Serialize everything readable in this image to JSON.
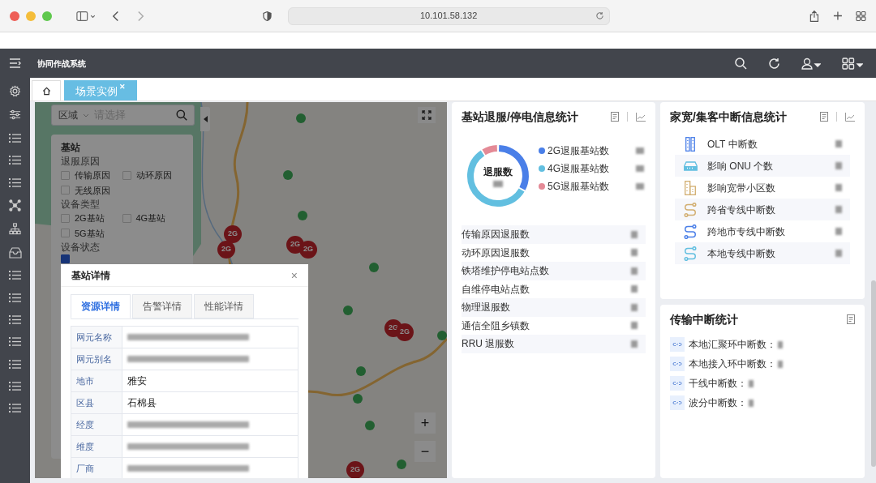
{
  "browser": {
    "address": "10.101.58.132"
  },
  "app": {
    "title": "协同作战系统"
  },
  "sidebar": {
    "items": [
      {
        "kind": "gear"
      },
      {
        "kind": "sliders"
      },
      {
        "kind": "list"
      },
      {
        "kind": "list"
      },
      {
        "kind": "list"
      },
      {
        "kind": "nodes"
      },
      {
        "kind": "hierarchy"
      },
      {
        "kind": "tray"
      },
      {
        "kind": "list"
      },
      {
        "kind": "list"
      },
      {
        "kind": "list"
      },
      {
        "kind": "list"
      },
      {
        "kind": "list"
      },
      {
        "kind": "list"
      },
      {
        "kind": "list"
      }
    ]
  },
  "tabs": [
    {
      "kind": "home",
      "selected": false
    },
    {
      "kind": "page",
      "label": "场景实例",
      "close": "✕",
      "selected": true
    }
  ],
  "map": {
    "region_label": "区域",
    "region_placeholder": "请选择",
    "markers": [
      {
        "label": "2G"
      },
      {
        "label": "2G"
      },
      {
        "label": "2G"
      },
      {
        "label": "2G"
      },
      {
        "label": "2G"
      },
      {
        "label": "2G"
      },
      {
        "label": "2G"
      }
    ],
    "filter": {
      "title": "基站",
      "groups": [
        {
          "title": "退服原因",
          "options": [
            {
              "label": "传输原因",
              "checked": false
            },
            {
              "label": "动环原因",
              "checked": false
            },
            {
              "label": "无线原因",
              "checked": false
            }
          ]
        },
        {
          "title": "设备类型",
          "options": [
            {
              "label": "2G基站",
              "checked": false
            },
            {
              "label": "4G基站",
              "checked": false
            },
            {
              "label": "5G基站",
              "checked": false
            }
          ]
        },
        {
          "title": "设备状态",
          "options": [
            {
              "checked": true
            }
          ]
        }
      ]
    },
    "zoom_in": "+",
    "zoom_out": "−"
  },
  "dialog": {
    "title": "基站详情",
    "close": "×",
    "tabs": [
      {
        "label": "资源详情",
        "selected": true
      },
      {
        "label": "告警详情",
        "selected": false
      },
      {
        "label": "性能详情",
        "selected": false
      }
    ],
    "rows": [
      {
        "label": "网元名称",
        "redacted": true
      },
      {
        "label": "网元别名",
        "redacted": true
      },
      {
        "label": "地市",
        "value": "雅安",
        "redacted": false
      },
      {
        "label": "区县",
        "value": "石棉县",
        "redacted": false
      },
      {
        "label": "经度",
        "redacted": true
      },
      {
        "label": "维度",
        "redacted": true
      },
      {
        "label": "厂商",
        "redacted": true
      }
    ]
  },
  "outage_card": {
    "title": "基站退服/停电信息统计",
    "donut_label": "退服数",
    "legend": [
      {
        "label": "2G退服基站数",
        "color": "#4a7fe8"
      },
      {
        "label": "4G退服基站数",
        "color": "#62bfe0"
      },
      {
        "label": "5G退服基站数",
        "color": "#e48a96"
      }
    ],
    "stats": [
      {
        "label": "传输原因退服数"
      },
      {
        "label": "动环原因退服数"
      },
      {
        "label": "铁塔维护停电站点数"
      },
      {
        "label": "自维停电站点数"
      },
      {
        "label": "物理退服数"
      },
      {
        "label": "通信全阻乡镇数"
      },
      {
        "label": "RRU 退服数"
      }
    ]
  },
  "broadband_card": {
    "title": "家宽/集客中断信息统计",
    "rows": [
      {
        "kind": "rack",
        "color": "#4a7fe8",
        "label": "OLT 中断数"
      },
      {
        "kind": "router",
        "color": "#62bfe0",
        "label": "影响 ONU 个数"
      },
      {
        "kind": "building",
        "color": "#d2ae70",
        "label": "影响宽带小区数"
      },
      {
        "kind": "route",
        "color": "#d2ae70",
        "label": "跨省专线中断数"
      },
      {
        "kind": "route",
        "color": "#4a7fe8",
        "label": "跨地市专线中断数"
      },
      {
        "kind": "route",
        "color": "#62bfe0",
        "label": "本地专线中断数"
      }
    ]
  },
  "transport_card": {
    "title": "传输中断统计",
    "rows": [
      {
        "label": "本地汇聚环中断数："
      },
      {
        "label": "本地接入环中断数："
      },
      {
        "label": "干线中断数："
      },
      {
        "label": "波分中断数："
      }
    ]
  }
}
